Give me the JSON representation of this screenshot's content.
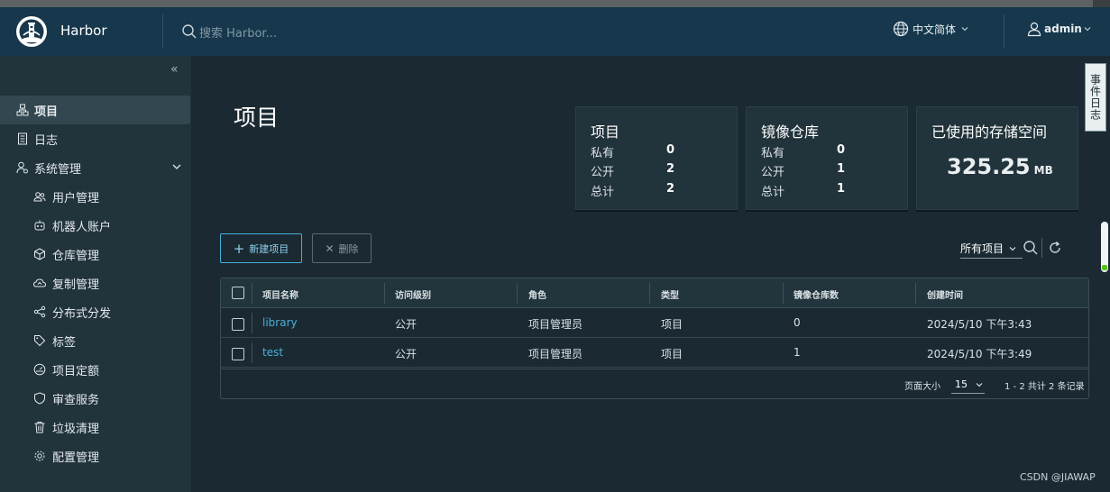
{
  "header": {
    "brand": "Harbor",
    "search_placeholder": "搜索 Harbor...",
    "language": "中文简体",
    "user": "admin"
  },
  "sidebar": {
    "items": [
      {
        "label": "项目",
        "icon": "projects-icon",
        "active": true
      },
      {
        "label": "日志",
        "icon": "logs-icon"
      },
      {
        "label": "系统管理",
        "icon": "admin-icon",
        "expandable": true
      },
      {
        "label": "用户管理",
        "icon": "users-icon"
      },
      {
        "label": "机器人账户",
        "icon": "robot-icon"
      },
      {
        "label": "仓库管理",
        "icon": "registry-icon"
      },
      {
        "label": "复制管理",
        "icon": "replication-icon"
      },
      {
        "label": "分布式分发",
        "icon": "share-icon"
      },
      {
        "label": "标签",
        "icon": "tag-icon"
      },
      {
        "label": "项目定额",
        "icon": "quota-icon"
      },
      {
        "label": "审查服务",
        "icon": "shield-icon"
      },
      {
        "label": "垃圾清理",
        "icon": "trash-icon"
      },
      {
        "label": "配置管理",
        "icon": "gear-icon"
      }
    ]
  },
  "main": {
    "title": "项目",
    "cards": {
      "projects": {
        "title": "项目",
        "rows": [
          {
            "label": "私有",
            "value": "0"
          },
          {
            "label": "公开",
            "value": "2"
          },
          {
            "label": "总计",
            "value": "2"
          }
        ]
      },
      "repos": {
        "title": "镜像仓库",
        "rows": [
          {
            "label": "私有",
            "value": "0"
          },
          {
            "label": "公开",
            "value": "1"
          },
          {
            "label": "总计",
            "value": "1"
          }
        ]
      },
      "storage": {
        "title": "已使用的存储空间",
        "value": "325.25",
        "unit": "MB"
      }
    },
    "toolbar": {
      "new_project": "新建项目",
      "delete": "删除",
      "filter": "所有项目"
    },
    "table": {
      "columns": [
        "项目名称",
        "访问级别",
        "角色",
        "类型",
        "镜像仓库数",
        "创建时间"
      ],
      "rows": [
        [
          "library",
          "公开",
          "项目管理员",
          "项目",
          "0",
          "2024/5/10 下午3:43"
        ],
        [
          "test",
          "公开",
          "项目管理员",
          "项目",
          "1",
          "2024/5/10 下午3:49"
        ]
      ],
      "page_size_label": "页面大小",
      "page_size": "15",
      "summary": "1 - 2 共计 2 条记录"
    }
  },
  "side_tab": "事件日志",
  "watermark": "CSDN @JIAWAP",
  "colors": {
    "header": "#17384c",
    "sidebar": "#21333b",
    "main": "#1b2a32",
    "accent": "#49afd9"
  }
}
